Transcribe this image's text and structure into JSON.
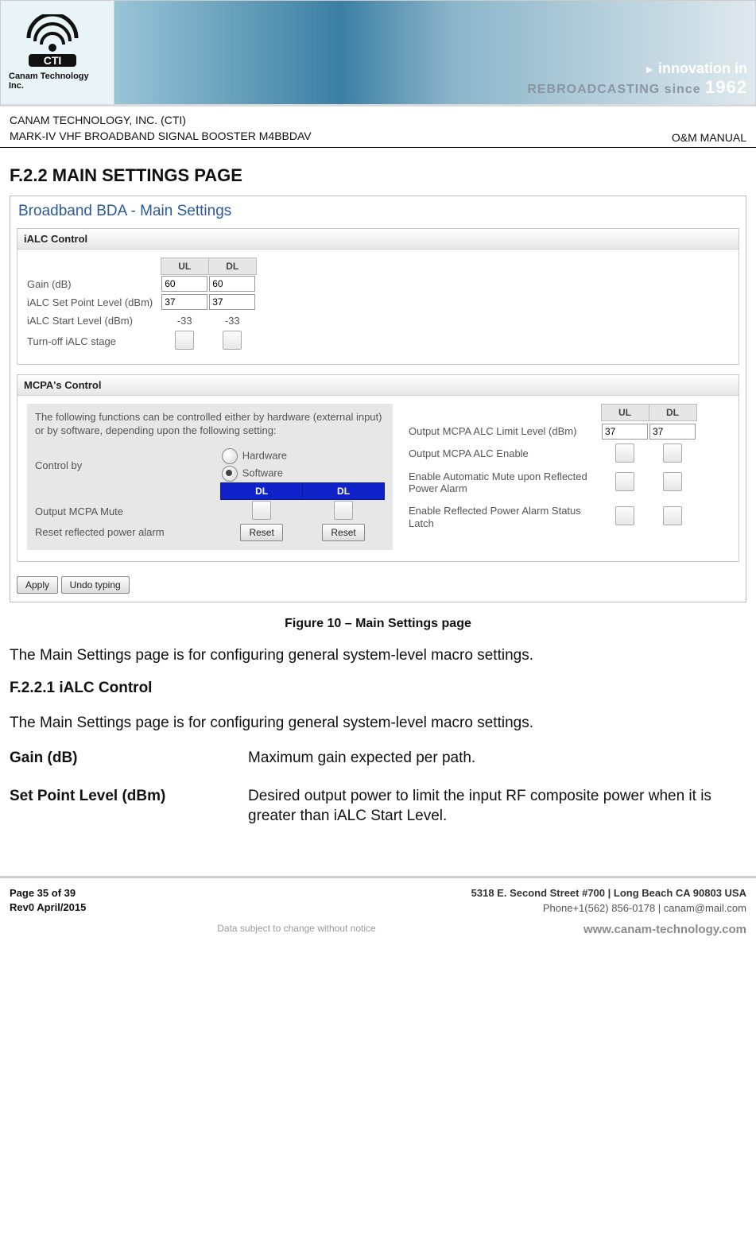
{
  "banner": {
    "logo_label": "Canam Technology Inc.",
    "innov_line1": "innovation in",
    "innov_line2_a": "REBROADCASTING",
    "innov_line2_b": "since",
    "innov_year": "1962"
  },
  "doc_header": {
    "company": "CANAM TECHNOLOGY, INC. (CTI)",
    "product": "MARK-IV VHF BROADBAND SIGNAL BOOSTER M4BBDAV",
    "doc_type": "O&M MANUAL"
  },
  "section": {
    "num_title": "F.2.2   MAIN SETTINGS PAGE"
  },
  "shot": {
    "title": "Broadband BDA - Main Settings",
    "ialc": {
      "header": "iALC Control",
      "col_ul": "UL",
      "col_dl": "DL",
      "rows": {
        "gain": {
          "label": "Gain (dB)",
          "ul": "60",
          "dl": "60"
        },
        "setpoint": {
          "label": "iALC Set Point Level (dBm)",
          "ul": "37",
          "dl": "37"
        },
        "start": {
          "label": "iALC Start Level (dBm)",
          "ul": "-33",
          "dl": "-33"
        },
        "turnoff": {
          "label": "Turn-off iALC stage"
        }
      }
    },
    "mcpa": {
      "header": "MCPA's Control",
      "intro": "The following functions can be controlled either by hardware (external input) or by software, depending upon the following setting:",
      "control_by_label": "Control by",
      "opt_hardware": "Hardware",
      "opt_software": "Software",
      "col_dl1": "DL",
      "col_dl2": "DL",
      "mute_label": "Output MCPA Mute",
      "reset_label": "Reset reflected power alarm",
      "reset_btn": "Reset",
      "right_col_ul": "UL",
      "right_col_dl": "DL",
      "r_rows": {
        "limit": {
          "label": "Output MCPA ALC Limit Level (dBm)",
          "ul": "37",
          "dl": "37"
        },
        "enable": {
          "label": "Output MCPA ALC Enable"
        },
        "automute": {
          "label": "Enable Automatic Mute upon Reflected Power Alarm"
        },
        "latch": {
          "label": "Enable Reflected Power Alarm Status Latch"
        }
      }
    },
    "apply_btn": "Apply",
    "undo_btn": "Undo typing"
  },
  "caption": "Figure 10 – Main Settings page",
  "para1": "The Main Settings page is for configuring general system-level macro settings.",
  "sub_section": "F.2.2.1     iALC Control",
  "para2": "The Main Settings page is for configuring general system-level macro settings.",
  "defs": {
    "gain": {
      "term": "Gain (dB)",
      "desc": "Maximum gain expected per path."
    },
    "setpoint": {
      "term": "Set Point Level (dBm)",
      "desc": "Desired output power to limit the input RF composite power when it is greater than iALC Start Level."
    }
  },
  "footer": {
    "page": "Page 35 of 39",
    "rev": "Rev0 April/2015",
    "addr": "5318 E. Second Street  #700 | Long Beach CA 90803 USA",
    "phone": "Phone+1(562) 856-0178 | canam@mail.com",
    "disclaimer": "Data subject to change without notice",
    "www": "www.canam-technology.com"
  }
}
